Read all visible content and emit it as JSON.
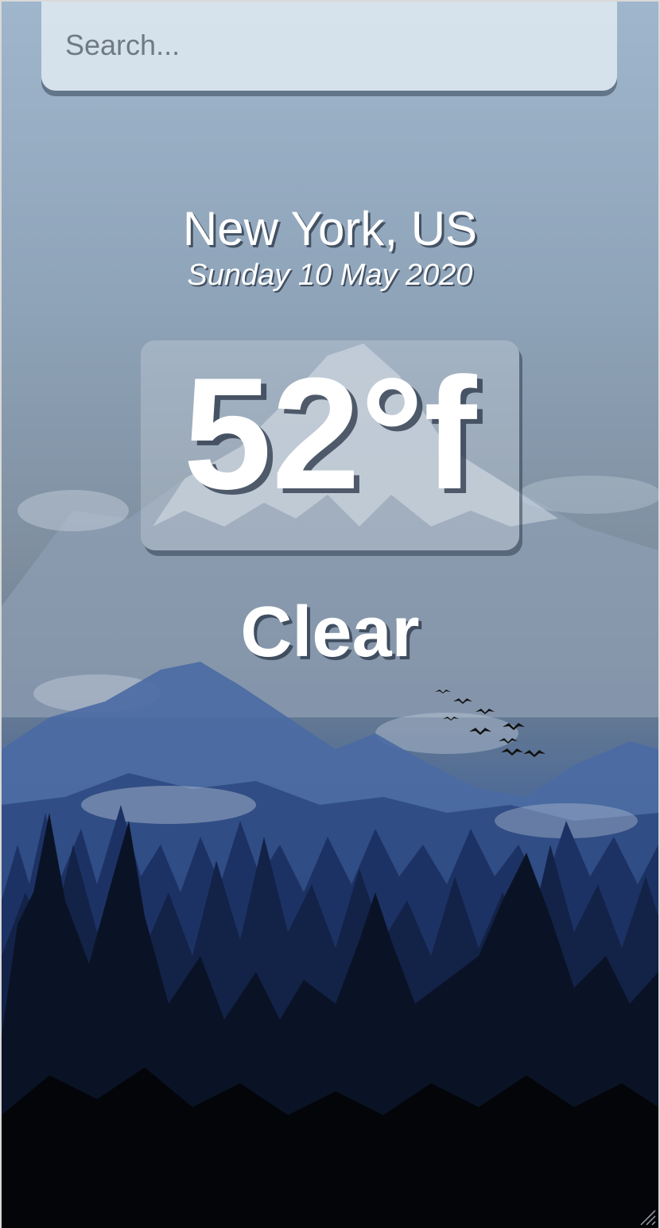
{
  "search": {
    "placeholder": "Search..."
  },
  "weather": {
    "location": "New York, US",
    "date": "Sunday 10 May 2020",
    "temperature": "52°f",
    "condition": "Clear"
  },
  "colors": {
    "sky_top": "#9fb6cc",
    "mountain_far": "#8fa0b6",
    "mountain_mid": "#4f6fa6",
    "forest_dark": "#071020",
    "text": "#ffffff",
    "text_shadow": "#2c3848"
  },
  "icons": {
    "resize_handle": "resize-grip-icon"
  }
}
